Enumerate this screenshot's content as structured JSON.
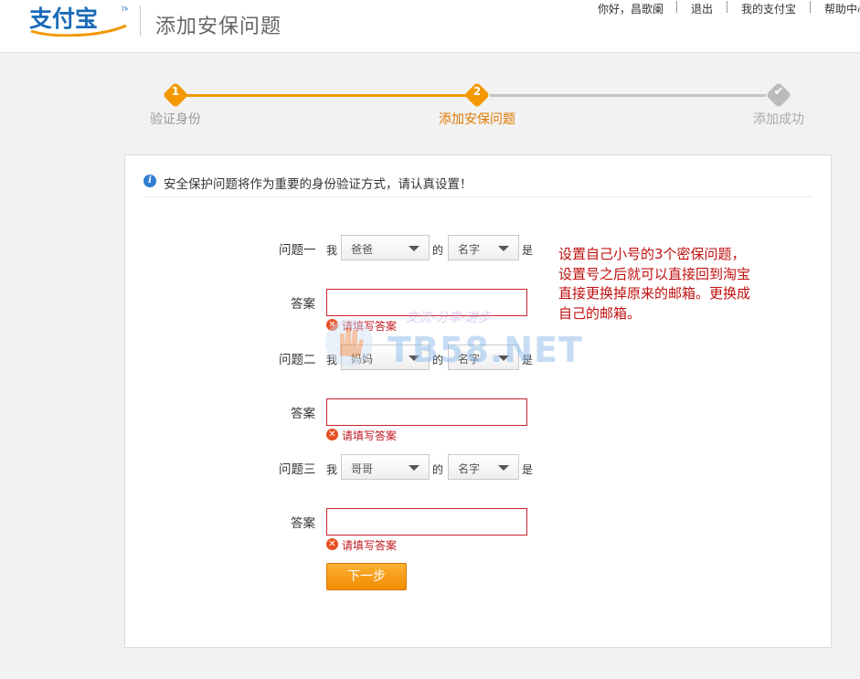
{
  "header": {
    "logo_text": "支付宝",
    "page_title": "添加安保问题",
    "greeting": "你好，昌歌阑",
    "logout": "退出",
    "my_alipay": "我的支付宝",
    "help": "帮助中心"
  },
  "steps": [
    {
      "num": "1",
      "label": "验证身份",
      "state": "done"
    },
    {
      "num": "2",
      "label": "添加安保问题",
      "state": "current"
    },
    {
      "num": "",
      "label": "添加成功",
      "state": "pending"
    }
  ],
  "colors": {
    "accent": "#f39800",
    "error": "#c1181f",
    "note": "#c10f0f",
    "pending": "#bbbbbb"
  },
  "tip": {
    "icon": "info-icon",
    "text": "安全保护问题将作为重要的身份验证方式，请认真设置！"
  },
  "questions": [
    {
      "label": "问题一",
      "me": "我",
      "relation": "爸爸",
      "of": "的",
      "attribute": "名字",
      "is": "是",
      "answer_label": "答案",
      "answer_value": "",
      "error": "请填写答案"
    },
    {
      "label": "问题二",
      "me": "我",
      "relation": "妈妈",
      "of": "的",
      "attribute": "名字",
      "is": "是",
      "answer_label": "答案",
      "answer_value": "",
      "error": "请填写答案"
    },
    {
      "label": "问题三",
      "me": "我",
      "relation": "哥哥",
      "of": "的",
      "attribute": "名字",
      "is": "是",
      "answer_label": "答案",
      "answer_value": "",
      "error": "请填写答案"
    }
  ],
  "next_button": "下一步",
  "note_lines": [
    "设置自己小号的3个密保问题，",
    "设置号之后就可以直接回到淘宝",
    "直接更换掉原来的邮箱。更换成",
    "自己的邮箱。"
  ],
  "watermark": {
    "slogan": "交流·分享·进步",
    "text": "TB58.NET"
  }
}
